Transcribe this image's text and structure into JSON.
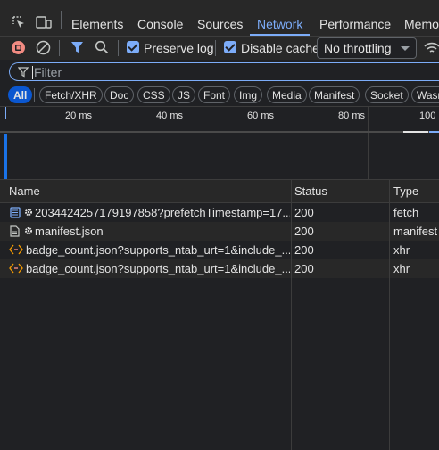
{
  "tabs": [
    "Elements",
    "Console",
    "Sources",
    "Network",
    "Performance",
    "Memor"
  ],
  "active_tab": "Network",
  "toolbar": {
    "preserve_log_label": "Preserve log",
    "preserve_log_checked": true,
    "disable_cache_label": "Disable cache",
    "disable_cache_checked": true,
    "throttling_value": "No throttling"
  },
  "filter": {
    "placeholder": "Filter"
  },
  "type_filters": [
    "All",
    "Fetch/XHR",
    "Doc",
    "CSS",
    "JS",
    "Font",
    "Img",
    "Media",
    "Manifest",
    "Socket",
    "Wasr"
  ],
  "active_type_filter": "All",
  "timeline": {
    "ticks": [
      "20 ms",
      "40 ms",
      "60 ms",
      "80 ms",
      "100"
    ]
  },
  "table": {
    "columns": [
      "Name",
      "Status",
      "Type"
    ],
    "rows": [
      {
        "icon": "document-icon",
        "gear": true,
        "name": "2034424257179197858?prefetchTimestamp=17...",
        "status": "200",
        "type": "fetch"
      },
      {
        "icon": "file-icon",
        "gear": true,
        "name": "manifest.json",
        "status": "200",
        "type": "manifest"
      },
      {
        "icon": "xhr-icon",
        "gear": false,
        "name": "badge_count.json?supports_ntab_urt=1&include_...",
        "status": "200",
        "type": "xhr"
      },
      {
        "icon": "xhr-icon",
        "gear": false,
        "name": "badge_count.json?supports_ntab_urt=1&include_...",
        "status": "200",
        "type": "xhr"
      }
    ]
  },
  "colors": {
    "accent": "#7cacf8",
    "record": "#f28b82",
    "xhr_icon": "#f29900",
    "selected_chip": "#0b57d0"
  }
}
